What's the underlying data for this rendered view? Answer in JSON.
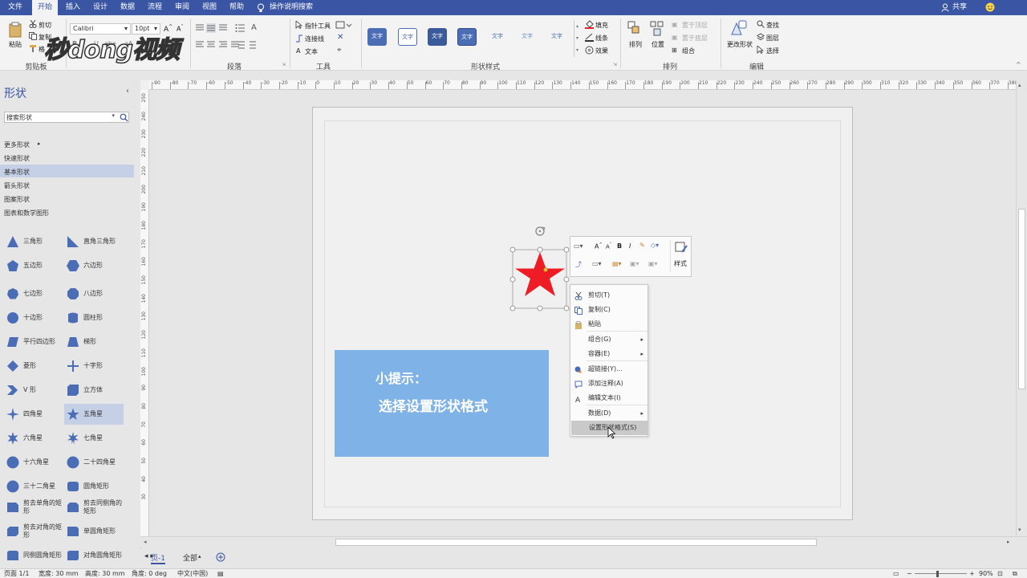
{
  "menu": {
    "items": [
      "文件",
      "开始",
      "插入",
      "设计",
      "数据",
      "流程",
      "审阅",
      "视图",
      "帮助"
    ],
    "active_index": 1,
    "search_label": "操作说明搜索",
    "share_label": "共享"
  },
  "ribbon": {
    "clipboard": {
      "paste": "粘贴",
      "cut": "剪切",
      "copy": "复制",
      "format_painter": "格",
      "label": "剪贴板"
    },
    "font": {
      "name": "Calibri",
      "size": "10pt"
    },
    "paragraph_label": "段落",
    "tools": {
      "pointer": "指针工具",
      "connector": "连接线",
      "text": "文本",
      "label": "工具"
    },
    "shape_styles": {
      "style_text": "文字",
      "label": "形状样式",
      "fill": "填充",
      "line": "线条",
      "effect": "效果"
    },
    "arrange": {
      "arrange": "排列",
      "position": "位置",
      "bring_front": "置于顶层",
      "send_back": "置于底层",
      "group": "组合",
      "label": "排列"
    },
    "edit": {
      "change_shape": "更改形状",
      "find": "查找",
      "layers": "图层",
      "select": "选择",
      "label": "编辑"
    }
  },
  "watermark": "秒dong视频",
  "sidebar": {
    "title": "形状",
    "search_placeholder": "搜索形状",
    "categories": [
      "更多形状",
      "快速形状",
      "基本形状",
      "箭头形状",
      "图案形状",
      "图表和数学图形"
    ],
    "selected_category_index": 2,
    "shapes": [
      [
        "三角形",
        "直角三角形"
      ],
      [
        "五边形",
        "六边形"
      ],
      [
        "七边形",
        "八边形"
      ],
      [
        "十边形",
        "圆柱形"
      ],
      [
        "平行四边形",
        "梯形"
      ],
      [
        "菱形",
        "十字形"
      ],
      [
        "V 形",
        "立方体"
      ],
      [
        "四角星",
        "五角星"
      ],
      [
        "六角星",
        "七角星"
      ],
      [
        "十六角星",
        "二十四角星"
      ],
      [
        "三十二角星",
        "圆角矩形"
      ],
      [
        "剪去单角的矩形",
        "剪去同侧角的矩形"
      ],
      [
        "剪去对角的矩形",
        "单圆角矩形"
      ],
      [
        "同侧圆角矩形",
        "对角圆角矩形"
      ]
    ],
    "selected_shape": "五角星"
  },
  "ruler": {
    "h_ticks": [
      "-90",
      "-80",
      "-70",
      "-60",
      "-50",
      "-40",
      "-30",
      "-20",
      "-10",
      "0",
      "10",
      "20",
      "30",
      "40",
      "50",
      "60",
      "70",
      "80",
      "90",
      "100",
      "110",
      "120",
      "130",
      "140",
      "150",
      "160",
      "170",
      "180",
      "190",
      "200",
      "210",
      "220",
      "230",
      "240",
      "250",
      "260",
      "270",
      "280",
      "290",
      "300",
      "310",
      "320",
      "330",
      "340",
      "350",
      "360",
      "370",
      "380"
    ],
    "v_ticks": [
      "250",
      "240",
      "230",
      "220",
      "210",
      "200",
      "190",
      "180",
      "170",
      "160",
      "150",
      "140",
      "130",
      "120",
      "110",
      "100",
      "90",
      "80",
      "70",
      "60",
      "50",
      "40",
      "30"
    ]
  },
  "tip": {
    "line1": "小提示：",
    "line2": "选择设置形状格式"
  },
  "mini_toolbar": {
    "style_label": "样式"
  },
  "context_menu": [
    {
      "label": "剪切(T)",
      "icon": "cut-icon"
    },
    {
      "label": "复制(C)",
      "icon": "copy-icon"
    },
    {
      "label": "粘贴",
      "icon": "paste-icon"
    },
    {
      "label": "组合(G)",
      "submenu": true
    },
    {
      "label": "容器(E)",
      "submenu": true
    },
    {
      "label": "超链接(Y)...",
      "icon": "link-icon"
    },
    {
      "label": "添加注释(A)",
      "icon": "comment-icon"
    },
    {
      "label": "编辑文本(I)",
      "icon": "text-icon"
    },
    {
      "label": "数据(D)",
      "submenu": true
    },
    {
      "label": "设置形状格式(S)",
      "highlighted": true
    }
  ],
  "page_tabs": {
    "page": "页-1",
    "all": "全部"
  },
  "status": {
    "page": "页面 1/1",
    "width": "宽度: 30 mm",
    "height": "高度: 30 mm",
    "angle": "角度: 0 deg",
    "language": "中文(中国)",
    "zoom": "90%"
  },
  "colors": {
    "accent": "#3955a3",
    "star": "#ee1c24",
    "shape_blue": "#4a6db5",
    "tip_bg": "#7fb2e6"
  }
}
